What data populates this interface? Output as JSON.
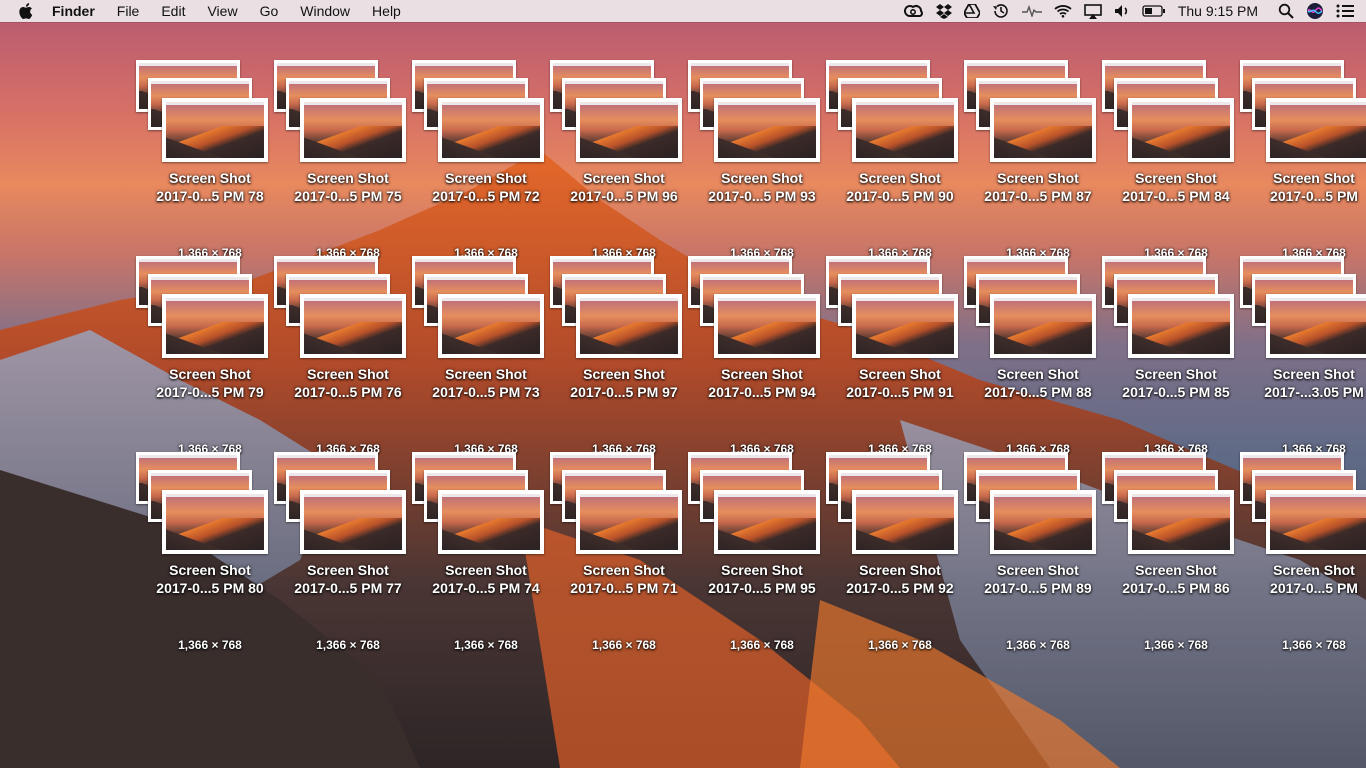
{
  "menubar": {
    "apple_icon": "apple-logo",
    "items": [
      "Finder",
      "File",
      "Edit",
      "View",
      "Go",
      "Window",
      "Help"
    ],
    "clock": "Thu 9:15 PM",
    "status_icons": [
      "creative-cloud-icon",
      "dropbox-icon",
      "google-drive-icon",
      "time-machine-icon",
      "activity-icon",
      "wifi-icon",
      "airplay-icon",
      "volume-icon",
      "battery-icon",
      "spotlight-icon",
      "siri-icon",
      "notification-center-icon"
    ]
  },
  "desktop": {
    "files": [
      {
        "name_line1": "Screen Shot",
        "name_line2": "2017-0...5 PM 78",
        "dims": "1,366 × 768"
      },
      {
        "name_line1": "Screen Shot",
        "name_line2": "2017-0...5 PM 75",
        "dims": "1,366 × 768"
      },
      {
        "name_line1": "Screen Shot",
        "name_line2": "2017-0...5 PM 72",
        "dims": "1,366 × 768"
      },
      {
        "name_line1": "Screen Shot",
        "name_line2": "2017-0...5 PM 96",
        "dims": "1,366 × 768"
      },
      {
        "name_line1": "Screen Shot",
        "name_line2": "2017-0...5 PM 93",
        "dims": "1,366 × 768"
      },
      {
        "name_line1": "Screen Shot",
        "name_line2": "2017-0...5 PM 90",
        "dims": "1,366 × 768"
      },
      {
        "name_line1": "Screen Shot",
        "name_line2": "2017-0...5 PM 87",
        "dims": "1,366 × 768"
      },
      {
        "name_line1": "Screen Shot",
        "name_line2": "2017-0...5 PM 84",
        "dims": "1,366 × 768"
      },
      {
        "name_line1": "Screen Shot",
        "name_line2": "2017-0...5 PM",
        "dims": "1,366 × 768"
      },
      {
        "name_line1": "Screen Shot",
        "name_line2": "2017-0...5 PM 79",
        "dims": "1,366 × 768"
      },
      {
        "name_line1": "Screen Shot",
        "name_line2": "2017-0...5 PM 76",
        "dims": "1,366 × 768"
      },
      {
        "name_line1": "Screen Shot",
        "name_line2": "2017-0...5 PM 73",
        "dims": "1,366 × 768"
      },
      {
        "name_line1": "Screen Shot",
        "name_line2": "2017-0...5 PM 97",
        "dims": "1,366 × 768"
      },
      {
        "name_line1": "Screen Shot",
        "name_line2": "2017-0...5 PM 94",
        "dims": "1,366 × 768"
      },
      {
        "name_line1": "Screen Shot",
        "name_line2": "2017-0...5 PM 91",
        "dims": "1,366 × 768"
      },
      {
        "name_line1": "Screen Shot",
        "name_line2": "2017-0...5 PM 88",
        "dims": "1,366 × 768"
      },
      {
        "name_line1": "Screen Shot",
        "name_line2": "2017-0...5 PM 85",
        "dims": "1,366 × 768"
      },
      {
        "name_line1": "Screen Shot",
        "name_line2": "2017-...3.05 PM",
        "dims": "1,366 × 768"
      },
      {
        "name_line1": "Screen Shot",
        "name_line2": "2017-0...5 PM 80",
        "dims": "1,366 × 768"
      },
      {
        "name_line1": "Screen Shot",
        "name_line2": "2017-0...5 PM 77",
        "dims": "1,366 × 768"
      },
      {
        "name_line1": "Screen Shot",
        "name_line2": "2017-0...5 PM 74",
        "dims": "1,366 × 768"
      },
      {
        "name_line1": "Screen Shot",
        "name_line2": "2017-0...5 PM 71",
        "dims": "1,366 × 768"
      },
      {
        "name_line1": "Screen Shot",
        "name_line2": "2017-0...5 PM 95",
        "dims": "1,366 × 768"
      },
      {
        "name_line1": "Screen Shot",
        "name_line2": "2017-0...5 PM 92",
        "dims": "1,366 × 768"
      },
      {
        "name_line1": "Screen Shot",
        "name_line2": "2017-0...5 PM 89",
        "dims": "1,366 × 768"
      },
      {
        "name_line1": "Screen Shot",
        "name_line2": "2017-0...5 PM 86",
        "dims": "1,366 × 768"
      },
      {
        "name_line1": "Screen Shot",
        "name_line2": "2017-0...5 PM",
        "dims": "1,366 × 768"
      }
    ]
  }
}
